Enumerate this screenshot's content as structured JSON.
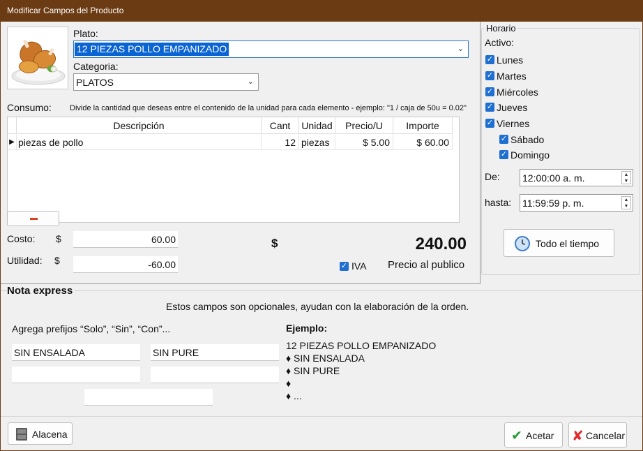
{
  "window": {
    "title": "Modificar Campos del Producto"
  },
  "product": {
    "plato_label": "Plato:",
    "plato_value": "12 PIEZAS POLLO EMPANIZADO",
    "categoria_label": "Categoria:",
    "categoria_value": "PLATOS",
    "image_icon": "fried-chicken-dish"
  },
  "consumo": {
    "label": "Consumo:",
    "hint": "Divide la cantidad que deseas entre el contenido de la unidad para cada elemento -  ejemplo: \"1 / caja de 50u = 0.02\"",
    "columns": [
      "Descripción",
      "Cant",
      "Unidad",
      "Precio/U",
      "Importe"
    ],
    "rows": [
      {
        "descripcion": "piezas de pollo",
        "cant": "12",
        "unidad": "piezas",
        "precio": "$ 5.00",
        "importe": "$ 60.00"
      }
    ],
    "remove_button": "−"
  },
  "costs": {
    "costo_label": "Costo:",
    "costo_currency": "$",
    "costo_value": "60.00",
    "utilidad_label": "Utilidad:",
    "utilidad_currency": "$",
    "utilidad_value": "-60.00",
    "price_currency": "$",
    "price_value": "240.00",
    "iva_label": "IVA",
    "iva_checked": true,
    "price_caption": "Precio al publico"
  },
  "horario": {
    "title": "Horario",
    "activo_label": "Activo:",
    "days": [
      {
        "label": "Lunes",
        "checked": true
      },
      {
        "label": "Martes",
        "checked": true
      },
      {
        "label": "Miércoles",
        "checked": true
      },
      {
        "label": "Jueves",
        "checked": true
      },
      {
        "label": "Viernes",
        "checked": true
      },
      {
        "label": "Sábado",
        "checked": true
      },
      {
        "label": "Domingo",
        "checked": true
      }
    ],
    "de_label": "De:",
    "de_value": "12:00:00 a. m.",
    "hasta_label": "hasta:",
    "hasta_value": "11:59:59 p. m.",
    "todo_button": "Todo el tiempo"
  },
  "nota": {
    "title": "Nota express",
    "subtitle": "Estos campos son opcionales, ayudan con la elaboración de la orden.",
    "prefijos_label": "Agrega prefijos “Solo”, “Sin”,  “Con”...",
    "fields": [
      "SIN ENSALADA",
      "SIN PURE",
      "",
      "",
      ""
    ],
    "ejemplo_label": "Ejemplo:",
    "ejemplo_lines": [
      "12 PIEZAS POLLO EMPANIZADO",
      "♦ SIN ENSALADA",
      "♦ SIN PURE",
      "♦",
      "♦ ..."
    ]
  },
  "footer": {
    "alacena_button": "Alacena",
    "aceptar_button": "Acetar",
    "cancelar_button": "Cancelar"
  },
  "colors": {
    "titlebar": "#6b3b13",
    "accent": "#1f6fd1",
    "selection": "#0a64d2",
    "remove": "#d9401b"
  }
}
